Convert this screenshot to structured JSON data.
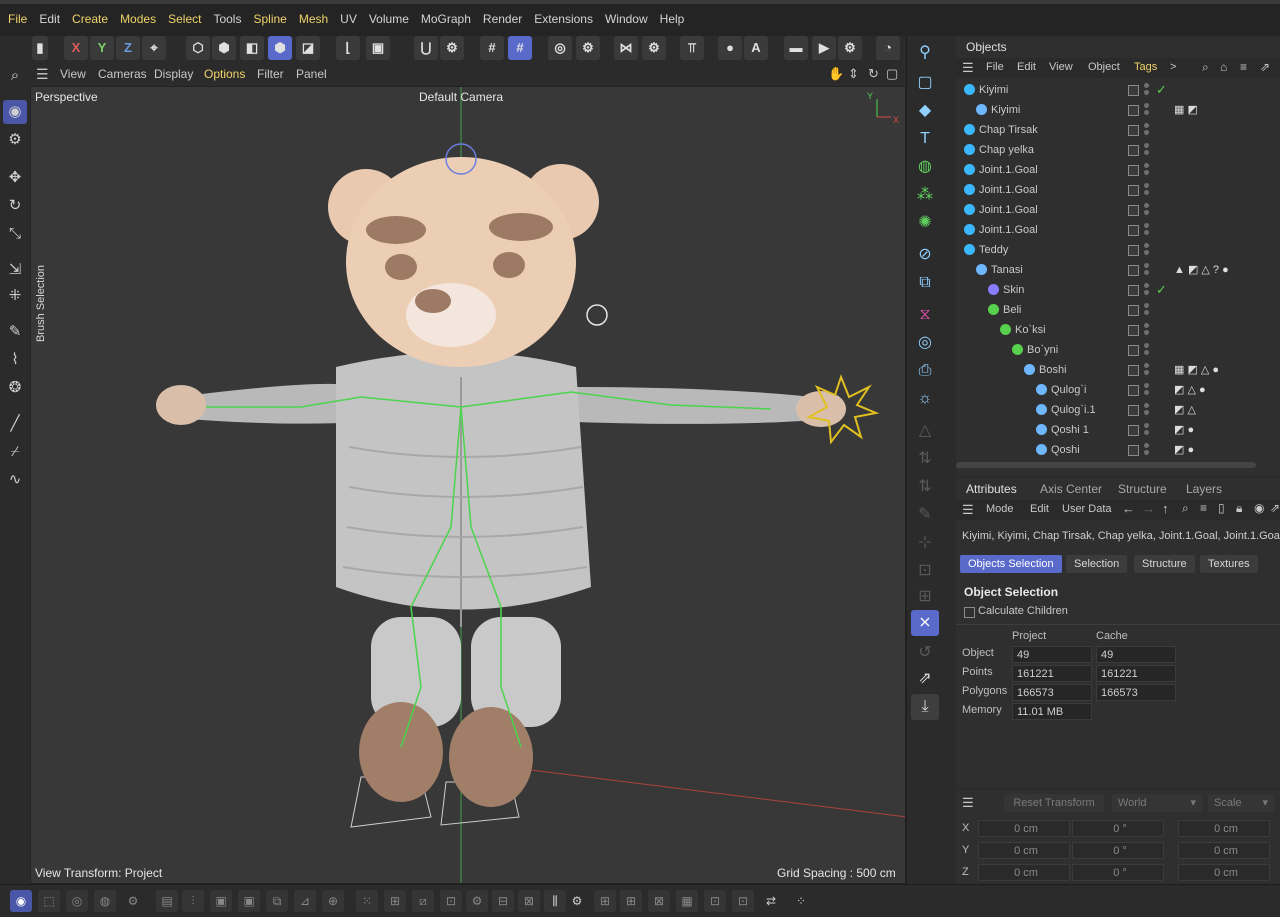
{
  "menubar": {
    "items": [
      {
        "label": "File",
        "highlight": true
      },
      {
        "label": "Edit",
        "highlight": false
      },
      {
        "label": "Create",
        "highlight": true
      },
      {
        "label": "Modes",
        "highlight": true
      },
      {
        "label": "Select",
        "highlight": true
      },
      {
        "label": "Tools",
        "highlight": false
      },
      {
        "label": "Spline",
        "highlight": true
      },
      {
        "label": "Mesh",
        "highlight": true
      },
      {
        "label": "UV",
        "highlight": false
      },
      {
        "label": "Volume",
        "highlight": false
      },
      {
        "label": "MoGraph",
        "highlight": false
      },
      {
        "label": "Render",
        "highlight": false
      },
      {
        "label": "Extensions",
        "highlight": false
      },
      {
        "label": "Window",
        "highlight": false
      },
      {
        "label": "Help",
        "highlight": false
      }
    ]
  },
  "toolbar": {
    "axis_x": "X",
    "axis_y": "Y",
    "axis_z": "Z"
  },
  "viewport_menu": {
    "items": [
      "View",
      "Cameras",
      "Display",
      "Options",
      "Filter",
      "Panel"
    ],
    "highlight": "Options"
  },
  "viewport": {
    "view_name": "Perspective",
    "camera": "Default Camera",
    "view_transform": "View Transform: Project",
    "grid_spacing": "Grid Spacing : 500 cm",
    "brush_selection": "Brush Selection"
  },
  "objects_panel": {
    "tab": "Objects",
    "menu": [
      "File",
      "Edit",
      "View",
      "Object",
      "Tags"
    ],
    "menu_more": ">",
    "rows": [
      {
        "name": "Kiyimi",
        "tick": true,
        "tags": ""
      },
      {
        "name": "Kiyimi",
        "tick": false,
        "tags": "▦ ◩"
      },
      {
        "name": "Chap Tirsak",
        "tick": false,
        "tags": ""
      },
      {
        "name": "Chap yelka",
        "tick": false,
        "tags": ""
      },
      {
        "name": "Joint.1.Goal",
        "tick": false,
        "tags": ""
      },
      {
        "name": "Joint.1.Goal",
        "tick": false,
        "tags": ""
      },
      {
        "name": "Joint.1.Goal",
        "tick": false,
        "tags": ""
      },
      {
        "name": "Joint.1.Goal",
        "tick": false,
        "tags": ""
      },
      {
        "name": "Teddy",
        "tick": false,
        "tags": ""
      },
      {
        "name": "Tanasi",
        "tick": false,
        "tags": "▲ ◩ △ ? ●"
      },
      {
        "name": "Skin",
        "tick": true,
        "tags": ""
      },
      {
        "name": "Beli",
        "tick": false,
        "tags": ""
      },
      {
        "name": "Ko`ksi",
        "tick": false,
        "tags": ""
      },
      {
        "name": "Bo`yni",
        "tick": false,
        "tags": ""
      },
      {
        "name": "Boshi",
        "tick": false,
        "tags": "▦ ◩ △ ●"
      },
      {
        "name": "Qulog`i",
        "tick": false,
        "tags": "◩ △ ●"
      },
      {
        "name": "Qulog`i.1",
        "tick": false,
        "tags": "◩ △"
      },
      {
        "name": "Qoshi 1",
        "tick": false,
        "tags": "◩ ●"
      },
      {
        "name": "Qoshi",
        "tick": false,
        "tags": "◩ ●"
      }
    ]
  },
  "attributes_panel": {
    "tabs": [
      "Attributes",
      "Axis Center",
      "Structure",
      "Layers"
    ],
    "menu": [
      "Mode",
      "Edit",
      "User Data"
    ],
    "selection_line": "Kiyimi, Kiyimi, Chap Tirsak, Chap yelka, Joint.1.Goal, Joint.1.Goa...",
    "subtabs": [
      "Objects Selection",
      "Selection",
      "Structure",
      "Textures"
    ],
    "section_title": "Object Selection",
    "calc_children": "Calculate Children",
    "col_project": "Project",
    "col_cache": "Cache",
    "stats": [
      {
        "label": "Object",
        "project": "49",
        "cache": "49"
      },
      {
        "label": "Points",
        "project": "161221",
        "cache": "161221"
      },
      {
        "label": "Polygons",
        "project": "166573",
        "cache": "166573"
      },
      {
        "label": "Memory",
        "project": "11.01 MB",
        "cache": ""
      }
    ]
  },
  "coords_panel": {
    "reset": "Reset Transform",
    "space": "World",
    "mode": "Scale",
    "rows": [
      {
        "axis": "X",
        "pos": "0 cm",
        "rot": "0 °",
        "scale": "0 cm"
      },
      {
        "axis": "Y",
        "pos": "0 cm",
        "rot": "0 °",
        "scale": "0 cm"
      },
      {
        "axis": "Z",
        "pos": "0 cm",
        "rot": "0 °",
        "scale": "0 cm"
      }
    ]
  },
  "colors": {
    "accent": "#5a6acb",
    "menu_highlight": "#f0d36b",
    "check_green": "#57d04d"
  }
}
